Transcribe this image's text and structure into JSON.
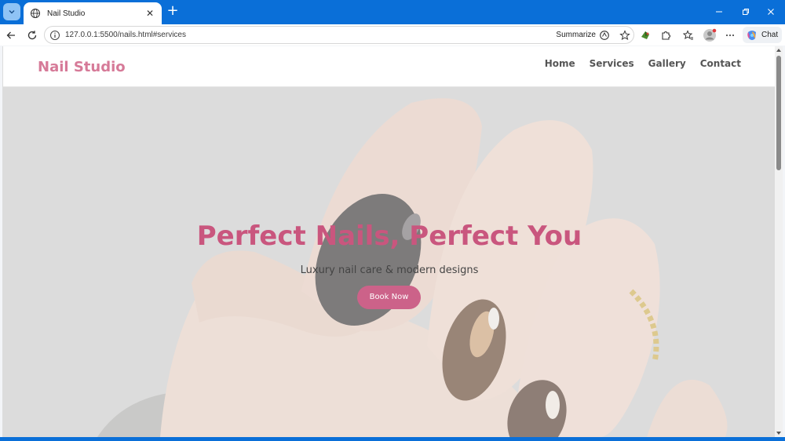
{
  "browser": {
    "tab_title": "Nail Studio",
    "url": "127.0.0.1:5500/nails.html#services",
    "summarize_label": "Summarize",
    "chat_label": "Chat",
    "new_tab_symbol": "+",
    "close_symbol": "✕",
    "minimize_symbol": "—",
    "restore_symbol": "❐",
    "window_close_symbol": "✕"
  },
  "site": {
    "logo": "Nail Studio",
    "nav": [
      "Home",
      "Services",
      "Gallery",
      "Contact"
    ],
    "hero": {
      "title": "Perfect Nails, Perfect You",
      "subtitle": "Luxury nail care & modern designs",
      "cta": "Book Now"
    }
  },
  "colors": {
    "accent": "#c9567e",
    "logo": "#d67a98",
    "button": "#cc6289",
    "browser_chrome": "#0a6fd8"
  },
  "icons": [
    "tab-menu-icon",
    "globe-icon",
    "back-icon",
    "refresh-icon",
    "info-icon",
    "summarize-icon",
    "star-icon",
    "extension-icon",
    "puzzle-icon",
    "favorites-icon",
    "profile-icon",
    "more-icon",
    "copilot-icon"
  ]
}
